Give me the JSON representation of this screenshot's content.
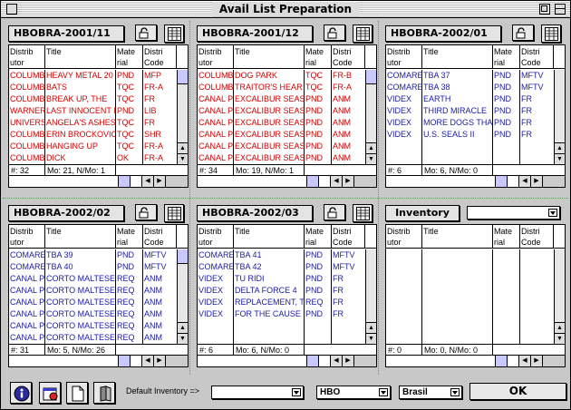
{
  "window": {
    "title": "Avail List Preparation"
  },
  "columns": {
    "distributor": "Distrib\nutor",
    "title": "Title",
    "material": "Mate\nrial",
    "district": "Distri\nCode"
  },
  "panels": [
    {
      "name": "HBOBRA-2001/11",
      "row_color": "red",
      "rows": [
        [
          "COLUMB",
          "HEAVY METAL 20",
          "PND",
          "MFP"
        ],
        [
          "COLUMB",
          "BATS",
          "TQC",
          "FR-A"
        ],
        [
          "COLUMB",
          "BREAK UP, THE",
          "TQC",
          "FR"
        ],
        [
          "WARNER",
          "LAST INNOCENT I",
          "PND",
          "LIB"
        ],
        [
          "UNIVERS",
          "ANGELA'S ASHES",
          "TQC",
          "FR"
        ],
        [
          "COLUMB",
          "ERIN BROCKOVIC",
          "TQC",
          "SHR"
        ],
        [
          "COLUMB",
          "HANGING UP",
          "TQC",
          "FR-A"
        ],
        [
          "COLUMB",
          "DICK",
          "OK",
          "FR-A"
        ]
      ],
      "count": "#: 32",
      "summary": "Mo: 21, N/Mo: 1"
    },
    {
      "name": "HBOBRA-2001/12",
      "row_color": "red",
      "rows": [
        [
          "COLUMB",
          "DOG PARK",
          "TQC",
          "FR-B"
        ],
        [
          "COLUMB",
          "TRAITOR'S HEAR",
          "TQC",
          "FR-A"
        ],
        [
          "CANAL P",
          "EXCALIBUR SEAS",
          "PND",
          "ANM"
        ],
        [
          "CANAL P",
          "EXCALIBUR SEAS",
          "PND",
          "ANM"
        ],
        [
          "CANAL P",
          "EXCALIBUR SEAS",
          "PND",
          "ANM"
        ],
        [
          "CANAL P",
          "EXCALIBUR SEAS",
          "PND",
          "ANM"
        ],
        [
          "CANAL P",
          "EXCALIBUR SEAS",
          "PND",
          "ANM"
        ],
        [
          "CANAL P",
          "EXCALIBUR SEAS",
          "PND",
          "ANM"
        ]
      ],
      "count": "#: 34",
      "summary": "Mo: 19, N/Mo: 1"
    },
    {
      "name": "HBOBRA-2002/01",
      "row_color": "blue",
      "rows": [
        [
          "COMARE",
          "TBA 37",
          "PND",
          "MFTV"
        ],
        [
          "COMARE",
          "TBA 38",
          "PND",
          "MFTV"
        ],
        [
          "VIDEX",
          "EARTH",
          "PND",
          "FR"
        ],
        [
          "VIDEX",
          "THIRD MIRACLE",
          "PND",
          "FR"
        ],
        [
          "VIDEX",
          "MORE DOGS THAI",
          "PND",
          "FR"
        ],
        [
          "VIDEX",
          "U.S. SEALS II",
          "PND",
          "FR"
        ]
      ],
      "count": "#: 6",
      "summary": "Mo: 6, N/Mo: 0"
    },
    {
      "name": "HBOBRA-2002/02",
      "row_color": "blue",
      "rows": [
        [
          "COMARE",
          "TBA 39",
          "PND",
          "MFTV"
        ],
        [
          "COMARE",
          "TBA 40",
          "PND",
          "MFTV"
        ],
        [
          "CANAL P",
          "CORTO MALTESE",
          "REQ",
          "ANM"
        ],
        [
          "CANAL P",
          "CORTO MALTESE",
          "REQ",
          "ANM"
        ],
        [
          "CANAL P",
          "CORTO MALTESE",
          "REQ",
          "ANM"
        ],
        [
          "CANAL P",
          "CORTO MALTESE",
          "REQ",
          "ANM"
        ],
        [
          "CANAL P",
          "CORTO MALTESE",
          "REQ",
          "ANM"
        ],
        [
          "CANAL P",
          "CORTO MALTESE",
          "REQ",
          "ANM"
        ]
      ],
      "count": "#: 31",
      "summary": "Mo: 5, N/Mo: 26"
    },
    {
      "name": "HBOBRA-2002/03",
      "row_color": "blue",
      "rows": [
        [
          "COMARE",
          "TBA 41",
          "PND",
          "MFTV"
        ],
        [
          "COMARE",
          "TBA 42",
          "PND",
          "MFTV"
        ],
        [
          "VIDEX",
          "TU RIDI",
          "PND",
          "FR"
        ],
        [
          "VIDEX",
          "DELTA FORCE 4",
          "PND",
          "FR"
        ],
        [
          "VIDEX",
          "REPLACEMENT, T",
          "REQ",
          "FR"
        ],
        [
          "VIDEX",
          "FOR THE CAUSE",
          "PND",
          "FR"
        ]
      ],
      "count": "#: 6",
      "summary": "Mo: 6, N/Mo: 0"
    }
  ],
  "inventory": {
    "button_label": "Inventory",
    "dropdown_value": "",
    "rows": [],
    "count": "#: 0",
    "summary": "Mo: 0, N/Mo: 0"
  },
  "bottom": {
    "default_inventory_label": "Default Inventory =>",
    "default_inventory_value": "",
    "network_value": "HBO",
    "country_value": "Brasil",
    "ok_label": "OK"
  },
  "colors": {
    "red_rows": "#d40000",
    "blue_rows": "#1a1aa8",
    "scroll_thumb": "#c8c8ff"
  }
}
